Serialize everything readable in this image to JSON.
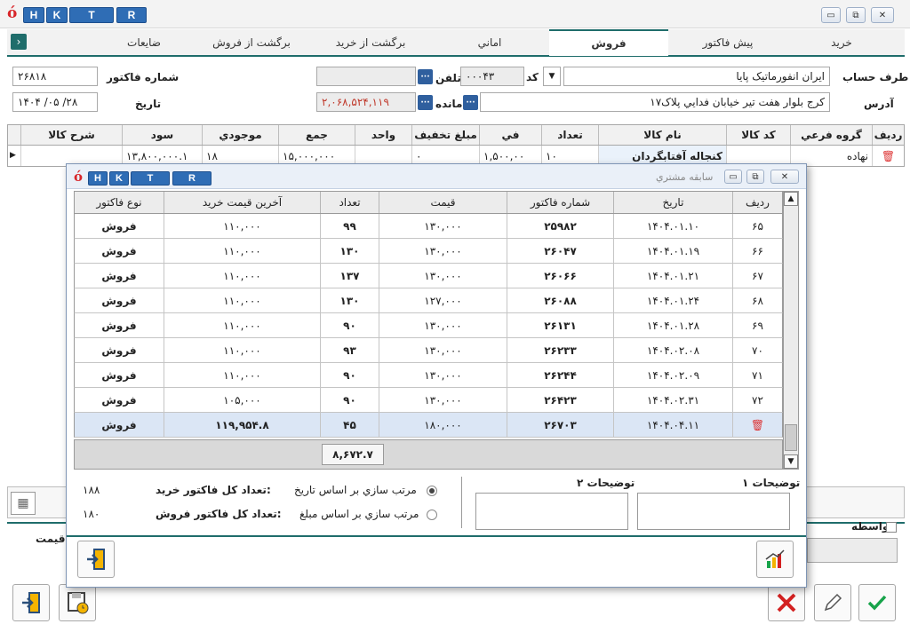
{
  "app": {
    "logo": "ó",
    "shortcut_keys": [
      "H",
      "K",
      "T",
      "R"
    ]
  },
  "tabs": [
    "خريد",
    "پيش فاکتور",
    "فروش",
    "اماني",
    "برگشت از خريد",
    "برگشت از فروش",
    "ضايعات"
  ],
  "active_tab": "فروش",
  "form": {
    "account_label": "طرف حساب",
    "account_value": "ايران انفورماتيک پايا",
    "code_label": "کد",
    "code_value": "۰۰۰۴۳",
    "phone_label": "تلفن",
    "phone_value": "",
    "invoice_no_label": "شماره فاکتور",
    "invoice_no_value": "۲۶۸۱۸",
    "address_label": "آدرس",
    "address_value": "کرج بلوار هفت تير خيابان فدايي پلاک۱۷",
    "balance_label": "مانده",
    "balance_value": "۲,۰۶۸,۵۲۴,۱۱۹",
    "date_label": "تاريخ",
    "date_value": "۱۴۰۴ /۰۵ /۲۸"
  },
  "main_grid": {
    "columns": [
      "رديف",
      "گروه فرعي",
      "کد کالا",
      "نام کالا",
      "تعداد",
      "في",
      "مبلغ تخفيف",
      "واحد",
      "جمع",
      "موجودي",
      "سود",
      "شرح کالا"
    ],
    "row": {
      "group": "نهاده",
      "name": "کنجاله آفتابگردان",
      "qty": "۱۰",
      "price": "۱,۵۰۰,۰۰",
      "discount": "۰",
      "unit": "",
      "total": "۱۵,۰۰۰,۰۰۰",
      "stock": "۱۸",
      "profit": "۱۳,۸۰۰,۰۰۰.۱",
      "desc": ""
    }
  },
  "bottom": {
    "mediator_label": "واسطه",
    "price_label": "قيمت"
  },
  "modal": {
    "title": "سابقه مشتري",
    "columns": [
      "رديف",
      "تاريخ",
      "شماره فاکتور",
      "قيمت",
      "تعداد",
      "آخرين قيمت خريد",
      "نوع فاکتور"
    ],
    "rows": [
      {
        "row": "۶۵",
        "date": "۱۴۰۴.۰۱.۱۰",
        "invoice": "۲۵۹۸۲",
        "price": "۱۳۰,۰۰۰",
        "qty": "۹۹",
        "last_buy": "۱۱۰,۰۰۰",
        "type": "فروش"
      },
      {
        "row": "۶۶",
        "date": "۱۴۰۴.۰۱.۱۹",
        "invoice": "۲۶۰۴۷",
        "price": "۱۳۰,۰۰۰",
        "qty": "۱۳۰",
        "last_buy": "۱۱۰,۰۰۰",
        "type": "فروش"
      },
      {
        "row": "۶۷",
        "date": "۱۴۰۴.۰۱.۲۱",
        "invoice": "۲۶۰۶۶",
        "price": "۱۳۰,۰۰۰",
        "qty": "۱۳۷",
        "last_buy": "۱۱۰,۰۰۰",
        "type": "فروش"
      },
      {
        "row": "۶۸",
        "date": "۱۴۰۴.۰۱.۲۴",
        "invoice": "۲۶۰۸۸",
        "price": "۱۲۷,۰۰۰",
        "qty": "۱۳۰",
        "last_buy": "۱۱۰,۰۰۰",
        "type": "فروش"
      },
      {
        "row": "۶۹",
        "date": "۱۴۰۴.۰۱.۲۸",
        "invoice": "۲۶۱۳۱",
        "price": "۱۳۰,۰۰۰",
        "qty": "۹۰",
        "last_buy": "۱۱۰,۰۰۰",
        "type": "فروش"
      },
      {
        "row": "۷۰",
        "date": "۱۴۰۴.۰۲.۰۸",
        "invoice": "۲۶۲۳۳",
        "price": "۱۳۰,۰۰۰",
        "qty": "۹۳",
        "last_buy": "۱۱۰,۰۰۰",
        "type": "فروش"
      },
      {
        "row": "۷۱",
        "date": "۱۴۰۴.۰۲.۰۹",
        "invoice": "۲۶۲۴۴",
        "price": "۱۳۰,۰۰۰",
        "qty": "۹۰",
        "last_buy": "۱۱۰,۰۰۰",
        "type": "فروش"
      },
      {
        "row": "۷۲",
        "date": "۱۴۰۴.۰۲.۳۱",
        "invoice": "۲۶۴۲۳",
        "price": "۱۳۰,۰۰۰",
        "qty": "۹۰",
        "last_buy": "۱۰۵,۰۰۰",
        "type": "فروش"
      },
      {
        "row": "",
        "date": "۱۴۰۴.۰۴.۱۱",
        "invoice": "۲۶۷۰۳",
        "price": "۱۸۰,۰۰۰",
        "qty": "۴۵",
        "last_buy": "۱۱۹,۹۵۴.۸",
        "type": "فروش"
      }
    ],
    "sum_value": "۸,۶۷۲.۷",
    "desc1_label": "توضيحات ۱",
    "desc2_label": "توضيحات ۲",
    "sort_by_date": "مرتب سازي بر اساس تاريخ",
    "sort_by_amount": "مرتب سازي بر اساس مبلغ",
    "total_buy_label": "تعداد کل فاکتور خريد:",
    "total_buy_value": "۱۸۸",
    "total_sell_label": "تعداد کل فاکتور فروش:",
    "total_sell_value": "۱۸۰"
  }
}
